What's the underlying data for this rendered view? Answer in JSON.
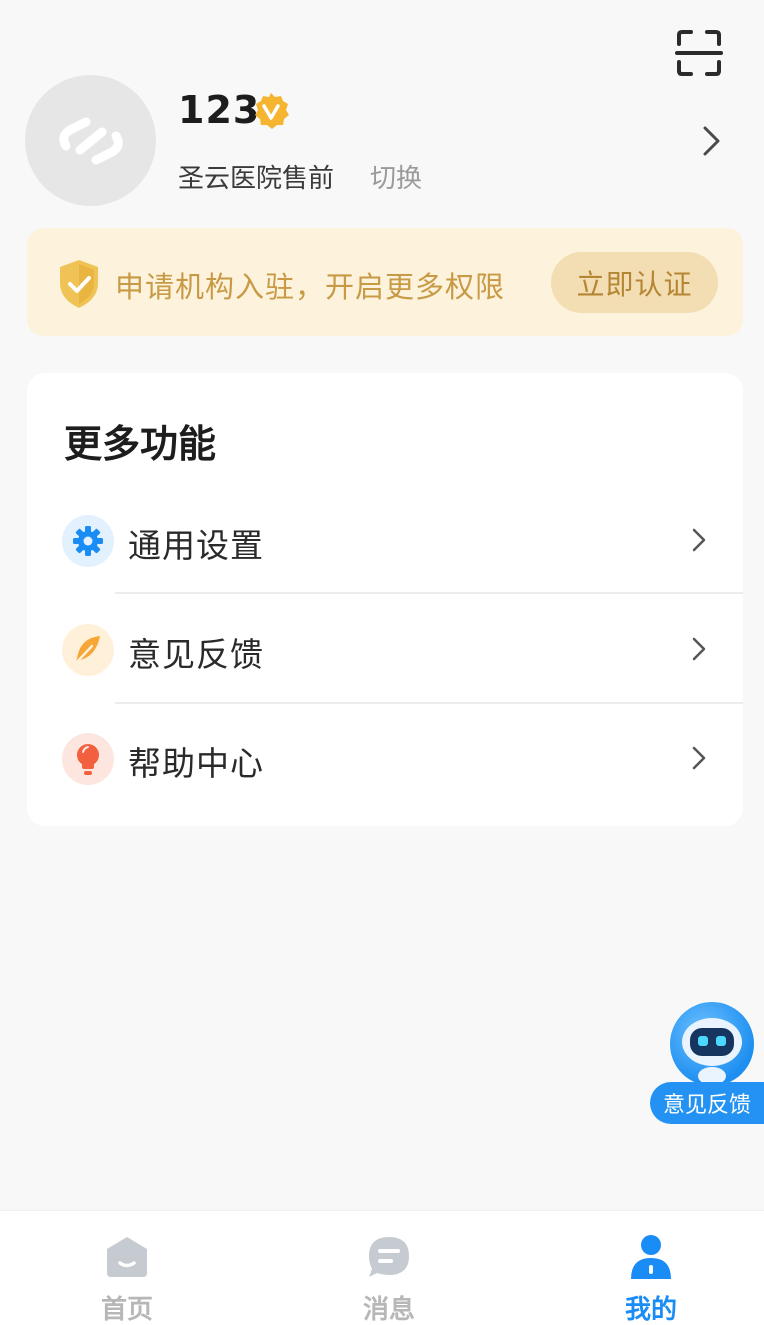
{
  "header": {
    "scan_icon": "scan-icon"
  },
  "profile": {
    "username": "123",
    "organization": "圣云医院售前",
    "switch_label": "切换",
    "avatar_icon": "app-logo-icon",
    "verified_icon": "verified-badge-icon"
  },
  "banner": {
    "text": "申请机构入驻，开启更多权限",
    "button_label": "立即认证",
    "icon": "shield-check-icon"
  },
  "more_features": {
    "title": "更多功能",
    "items": [
      {
        "label": "通用设置",
        "icon": "gear-icon",
        "color": "#1a8cf6"
      },
      {
        "label": "意见反馈",
        "icon": "feather-icon",
        "color": "#f7a534"
      },
      {
        "label": "帮助中心",
        "icon": "lightbulb-icon",
        "color": "#f2603f"
      }
    ]
  },
  "floating_button": {
    "label": "意见反馈",
    "icon": "robot-icon"
  },
  "tabbar": {
    "tabs": [
      {
        "label": "首页",
        "icon": "home-icon",
        "active": false
      },
      {
        "label": "消息",
        "icon": "message-icon",
        "active": false
      },
      {
        "label": "我的",
        "icon": "user-icon",
        "active": true
      }
    ]
  },
  "colors": {
    "accent": "#1a8cf6",
    "banner_bg": "#fdf2dc",
    "banner_text": "#c89a45"
  }
}
